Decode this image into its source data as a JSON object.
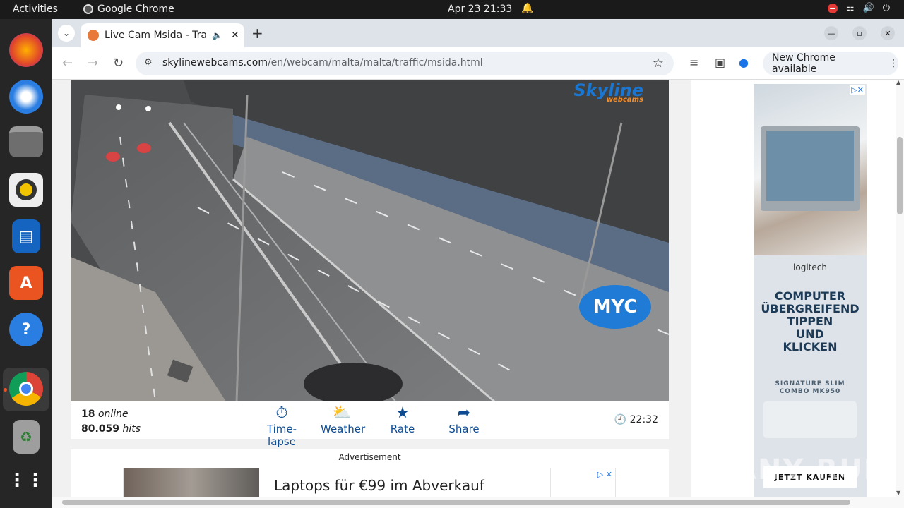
{
  "topbar": {
    "activities": "Activities",
    "app_name": "Google Chrome",
    "datetime": "Apr 23  21:33"
  },
  "dock": {
    "items": [
      "firefox-icon",
      "thunderbird-icon",
      "files-icon",
      "rhythmbox-icon",
      "writer-icon",
      "app-center-icon",
      "help-icon",
      "chrome-icon",
      "trash-icon",
      "show-apps-icon"
    ]
  },
  "browser": {
    "tab_title": "Live Cam Msida - Traffic",
    "url_host": "skylinewebcams.com",
    "url_path": "/en/webcam/malta/malta/traffic/msida.html",
    "update_label": "New Chrome available"
  },
  "cam": {
    "logo_text": "Skyline",
    "logo_sub": "webcams",
    "overlay_logo": "MYC"
  },
  "info": {
    "online_count": "18",
    "online_label": "online",
    "hits_count": "80.059",
    "hits_label": "hits",
    "actions": [
      "Time-lapse",
      "Weather",
      "Rate",
      "Share"
    ],
    "time": "22:32"
  },
  "ad": {
    "label": "Advertisement",
    "banner_text": "Laptops für €99 im Abverkauf"
  },
  "side_ad": {
    "brand": "logitech",
    "headline": "COMPUTER\nÜBERGREIFEND\nTIPPEN\nUND\nKLICKEN",
    "product": "SIGNATURE SLIM\nCOMBO MK950",
    "cta": "JETZT KAUFEN"
  },
  "watermark": "ANY RUN"
}
